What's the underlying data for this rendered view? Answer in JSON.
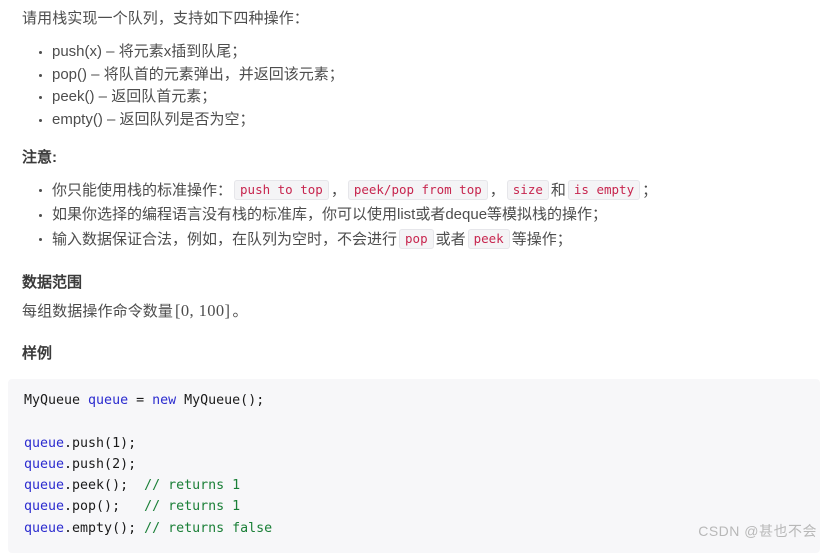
{
  "intro": {
    "text": "请用栈实现一个队列，支持如下四种操作："
  },
  "operations": [
    {
      "text": "push(x) – 将元素x插到队尾；"
    },
    {
      "text": "pop() – 将队首的元素弹出，并返回该元素；"
    },
    {
      "text": "peek() – 返回队首元素；"
    },
    {
      "text": "empty() – 返回队列是否为空；"
    }
  ],
  "notes_heading": "注意:",
  "notes": {
    "item1": {
      "prefix": "你只能使用栈的标准操作：",
      "code1": "push to top",
      "sep1": "，",
      "code2": "peek/pop from top",
      "sep2": "，",
      "code3": "size",
      "conj": "和",
      "code4": "is empty",
      "suffix": "；"
    },
    "item2": {
      "text": "如果你选择的编程语言没有栈的标准库，你可以使用list或者deque等模拟栈的操作；"
    },
    "item3": {
      "prefix": "输入数据保证合法，例如，在队列为空时，不会进行",
      "code1": "pop",
      "mid": "或者",
      "code2": "peek",
      "suffix": "等操作；"
    }
  },
  "range_heading": "数据范围",
  "range_body": {
    "prefix": "每组数据操作命令数量",
    "math": "[0, 100]",
    "suffix": "。"
  },
  "example_heading": "样例",
  "code": {
    "lines": [
      [
        {
          "t": "MyQueue ",
          "c": "txt"
        },
        {
          "t": "queue",
          "c": "var"
        },
        {
          "t": " = ",
          "c": "txt"
        },
        {
          "t": "new",
          "c": "kw"
        },
        {
          "t": " MyQueue();",
          "c": "txt"
        }
      ],
      [],
      [
        {
          "t": "queue",
          "c": "var"
        },
        {
          "t": ".push(1);",
          "c": "txt"
        }
      ],
      [
        {
          "t": "queue",
          "c": "var"
        },
        {
          "t": ".push(2);",
          "c": "txt"
        }
      ],
      [
        {
          "t": "queue",
          "c": "var"
        },
        {
          "t": ".peek();  ",
          "c": "txt"
        },
        {
          "t": "// returns 1",
          "c": "cmt"
        }
      ],
      [
        {
          "t": "queue",
          "c": "var"
        },
        {
          "t": ".pop();   ",
          "c": "txt"
        },
        {
          "t": "// returns 1",
          "c": "cmt"
        }
      ],
      [
        {
          "t": "queue",
          "c": "var"
        },
        {
          "t": ".empty(); ",
          "c": "txt"
        },
        {
          "t": "// returns false",
          "c": "cmt"
        }
      ]
    ]
  },
  "watermark": "CSDN @甚也不会",
  "colors": {
    "text": "#4d4d4d",
    "heading": "#3b3b3b",
    "inline_code_text": "#c7254e",
    "inline_code_bg": "#f4f4f6",
    "code_block_bg": "#f7f7f9",
    "code_keyword": "#2b2bcf",
    "code_comment": "#1a7f37",
    "watermark": "#b8b8b8"
  }
}
